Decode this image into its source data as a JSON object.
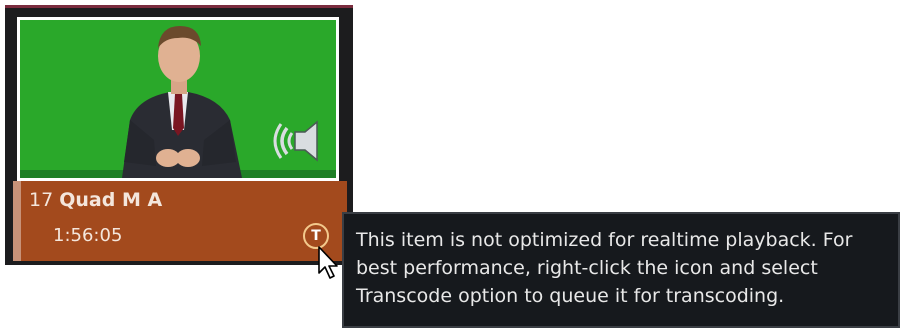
{
  "media_item": {
    "number": "17",
    "name": "Quad M A",
    "duration": "1:56:05",
    "transcode_badge": "T",
    "thumbnail": "anchorman-on-green-screen",
    "audio_icon": "speaker-icon"
  },
  "tooltip": {
    "lines": [
      "This item is not optimized for realtime playback. For",
      "best performance, right-click the icon and select",
      "Transcode option to queue it for transcoding."
    ]
  },
  "colors": {
    "green_screen": "#2aa82a",
    "tile_info_bg": "#a34a1d",
    "tile_accent": "#7a2c3e",
    "tooltip_bg": "#16191d"
  }
}
